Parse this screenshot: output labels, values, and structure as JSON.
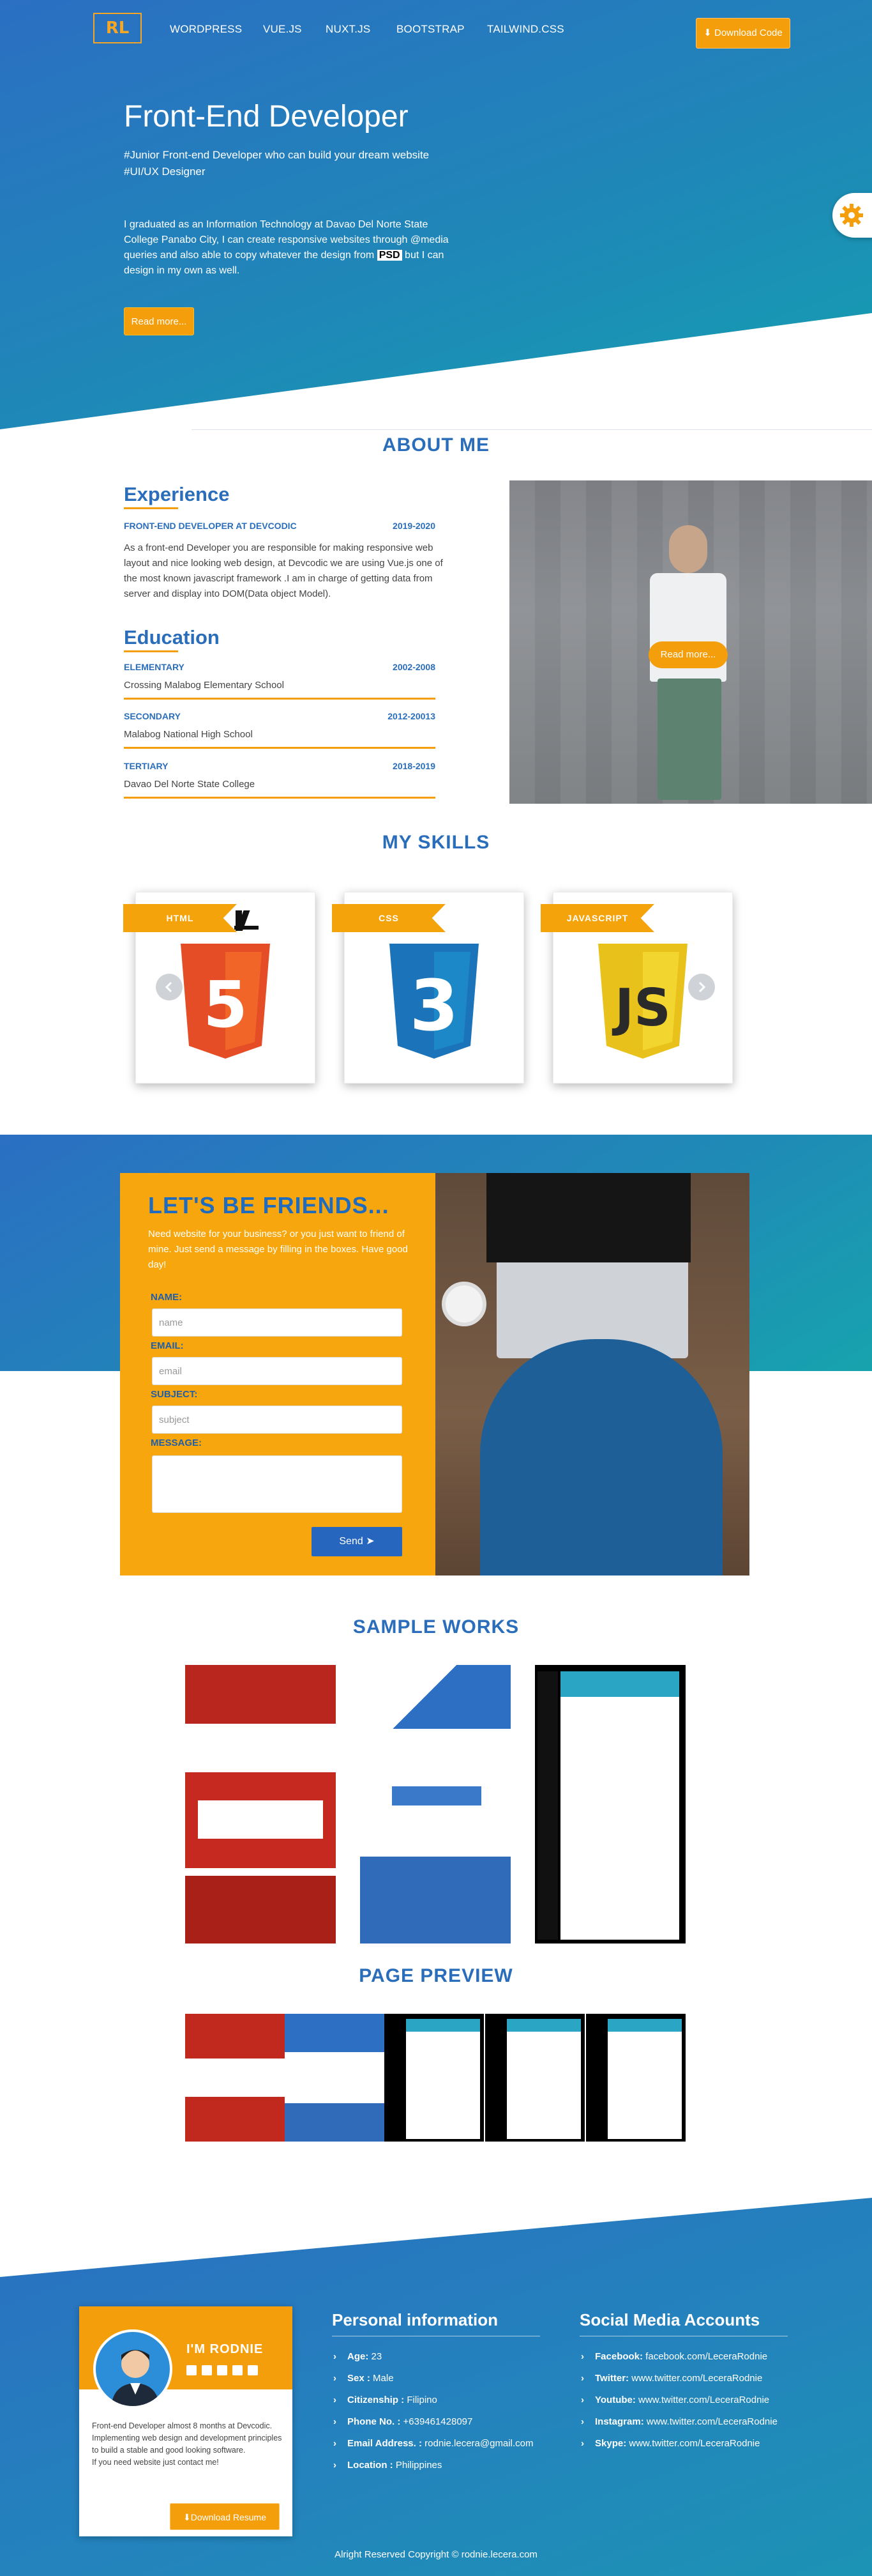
{
  "nav": {
    "logo": "RL",
    "links": [
      "WORDPRESS",
      "VUE.JS",
      "NUXT.JS",
      "BOOTSTRAP",
      "TAILWIND.CSS"
    ],
    "download_code": "Download Code"
  },
  "hero": {
    "title": "Front-End Developer",
    "tagline_1": "#Junior Front-end Developer who can build your dream website",
    "tagline_2": "#UI/UX Designer",
    "desc_1": "I graduated as an Information Technology at Davao Del Norte State College Panabo City, I can create responsive websites through @media queries and also able to copy whatever the design from",
    "desc_psd": "PSD",
    "desc_2": " but I can design in my own as well.",
    "read_more": "Read more..."
  },
  "about": {
    "title": "ABOUT ME",
    "experience_title": "Experience",
    "job_title": "FRONT-END DEVELOPER AT DEVCODIC",
    "job_years": "2019-2020",
    "job_desc": "As a front-end Developer you are responsible for making responsive web layout and nice looking web design, at Devcodic we are using Vue.js one of the most known javascript framework .I am in charge of getting data from server and display into DOM(Data object Model).",
    "education_title": "Education",
    "education": [
      {
        "level": "ELEMENTARY",
        "years": "2002-2008",
        "school": "Crossing Malabog Elementary School"
      },
      {
        "level": "SECONDARY",
        "years": "2012-20013",
        "school": "Malabog National High School"
      },
      {
        "level": "TERTIARY",
        "years": "2018-2019",
        "school": "Davao Del Norte State College"
      }
    ],
    "photo_read_more": "Read more..."
  },
  "skills": {
    "title": "MY SKILLS",
    "items": [
      {
        "label": "HTML",
        "icon": "html5-icon",
        "color": "#e44d26"
      },
      {
        "label": "CSS",
        "icon": "css3-icon",
        "color": "#1b73ba"
      },
      {
        "label": "JAVASCRIPT",
        "icon": "js-icon",
        "color": "#e8c21a"
      }
    ],
    "shield_text": [
      "5",
      "3",
      "JS"
    ]
  },
  "friends": {
    "title": "LET'S BE FRIENDS...",
    "subtitle": "Need website for your business? or you just want to friend of mine. Just send a message by filling in the boxes. Have good day!",
    "name_label": "NAME:",
    "name_placeholder": "name",
    "email_label": "EMAIL:",
    "email_placeholder": "email",
    "subject_label": "SUBJECT:",
    "subject_placeholder": "subject",
    "message_label": "MESSAGE:",
    "send": "Send"
  },
  "works": {
    "title": "SAMPLE WORKS",
    "preview_title": "PAGE PREVIEW"
  },
  "footer": {
    "name": "I'M RODNIE",
    "profile_desc": "Front-end Developer almost 8 months at Devcodic. Implementing web design and development principles to build a stable and good looking software.",
    "profile_desc_2": "If you need website just contact me!",
    "download_resume": "Download Resume",
    "personal_title": "Personal information",
    "personal": [
      {
        "label": "Age:",
        "value": " 23"
      },
      {
        "label": "Sex :",
        "value": " Male"
      },
      {
        "label": "Citizenship :",
        "value": " Filipino"
      },
      {
        "label": "Phone No. :",
        "value": " +639461428097"
      },
      {
        "label": "Email Address. :",
        "value": " rodnie.lecera@gmail.com"
      },
      {
        "label": "Location :",
        "value": " Philippines"
      }
    ],
    "social_title": "Social Media Accounts",
    "social": [
      {
        "label": "Facebook:",
        "value": " facebook.com/LeceraRodnie"
      },
      {
        "label": "Twitter:",
        "value": " www.twitter.com/LeceraRodnie"
      },
      {
        "label": "Youtube:",
        "value": " www.twitter.com/LeceraRodnie"
      },
      {
        "label": "Instagram:",
        "value": " www.twitter.com/LeceraRodnie"
      },
      {
        "label": "Skype:",
        "value": " www.twitter.com/LeceraRodnie"
      }
    ],
    "copyright": "Alright Reserved Copyright © rodnie.lecera.com"
  }
}
